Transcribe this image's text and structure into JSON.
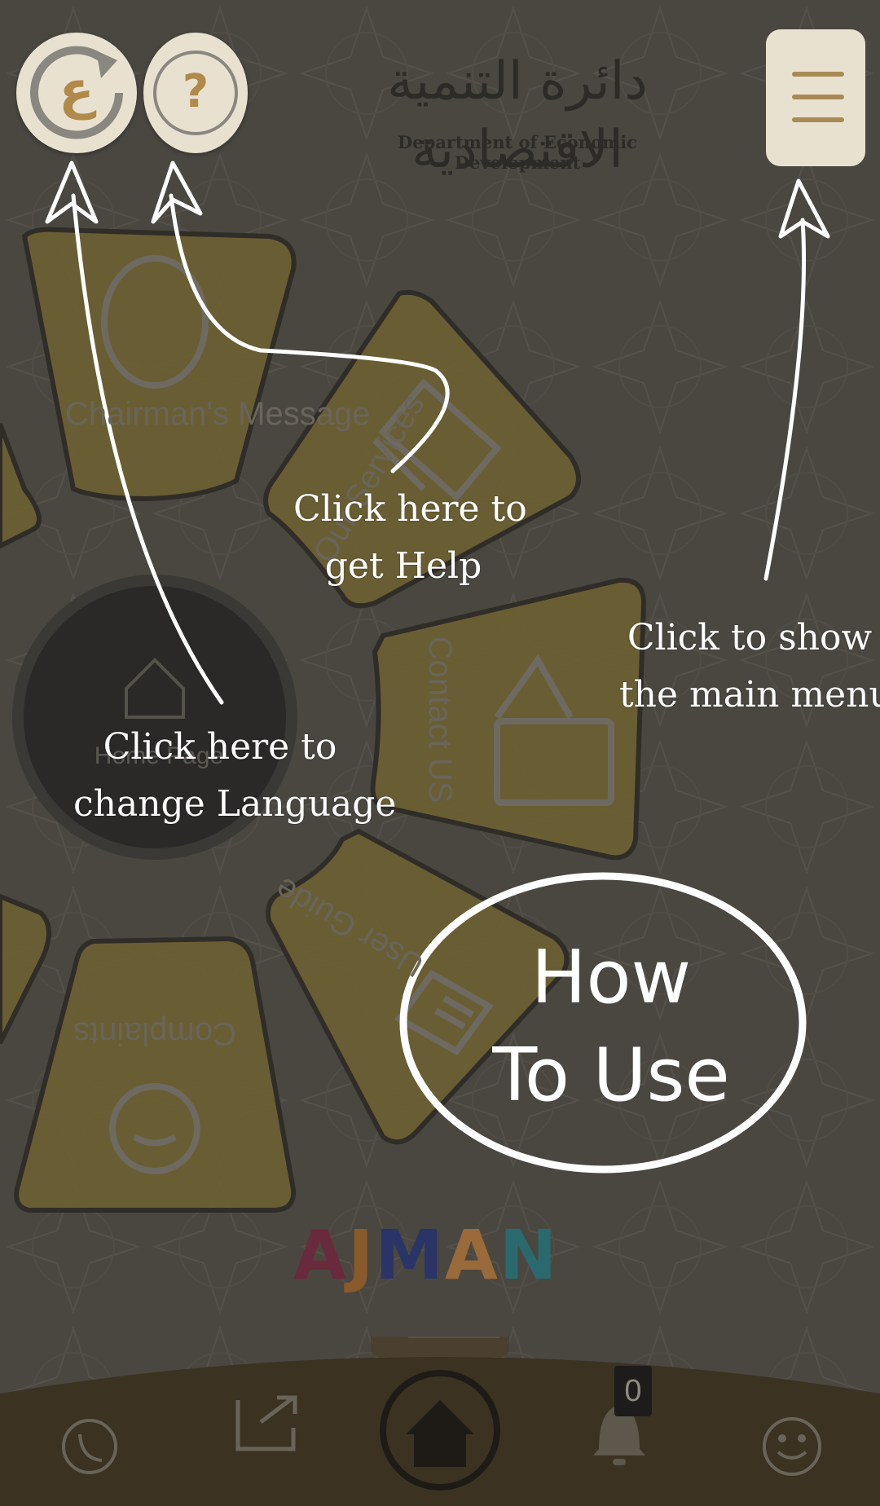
{
  "header": {
    "logo_arabic": "دائرة التنمية الاقتصادية",
    "logo_english": "Department of Economic Development",
    "language_button_glyph": "ع",
    "help_button_glyph": "?",
    "language_icon": "language-refresh-icon",
    "help_icon": "question-icon",
    "menu_icon": "hamburger-menu-icon"
  },
  "wheel": {
    "center_label": "Home Page",
    "items": [
      {
        "label": "Chairman's Message",
        "icon": "crest-icon"
      },
      {
        "label": "Our Services",
        "icon": "services-icon"
      },
      {
        "label": "Contact US",
        "icon": "contact-envelope-icon"
      },
      {
        "label": "User Guide",
        "icon": "guide-book-icon"
      },
      {
        "label": "Complaints",
        "icon": "complaints-face-icon"
      }
    ]
  },
  "overlay": {
    "language_hint_line1": "Click here to",
    "language_hint_line2": "change Language",
    "help_hint_line1": "Click here to",
    "help_hint_line2": "get Help",
    "menu_hint_line1": "Click to show",
    "menu_hint_line2": "the main menu",
    "how_to_line1": "How",
    "how_to_line2": "To Use"
  },
  "brand": {
    "ajman_letters": [
      "A",
      "J",
      "M",
      "A",
      "N"
    ],
    "ajman_colors": [
      "#7a1f3d",
      "#b06a1e",
      "#1e2d78",
      "#c07a2e",
      "#1b7c82"
    ]
  },
  "bottom_nav": {
    "notification_count": "0",
    "icons": [
      "phone-icon",
      "share-icon",
      "home-icon",
      "bell-icon",
      "smiley-icon"
    ]
  },
  "colors": {
    "overlay_bg": "#4a4741",
    "wedge": "#6b5f33",
    "bottom_bar": "#3b3222",
    "button_bg": "#e9e1d0",
    "accent_gold": "#a88a55"
  }
}
